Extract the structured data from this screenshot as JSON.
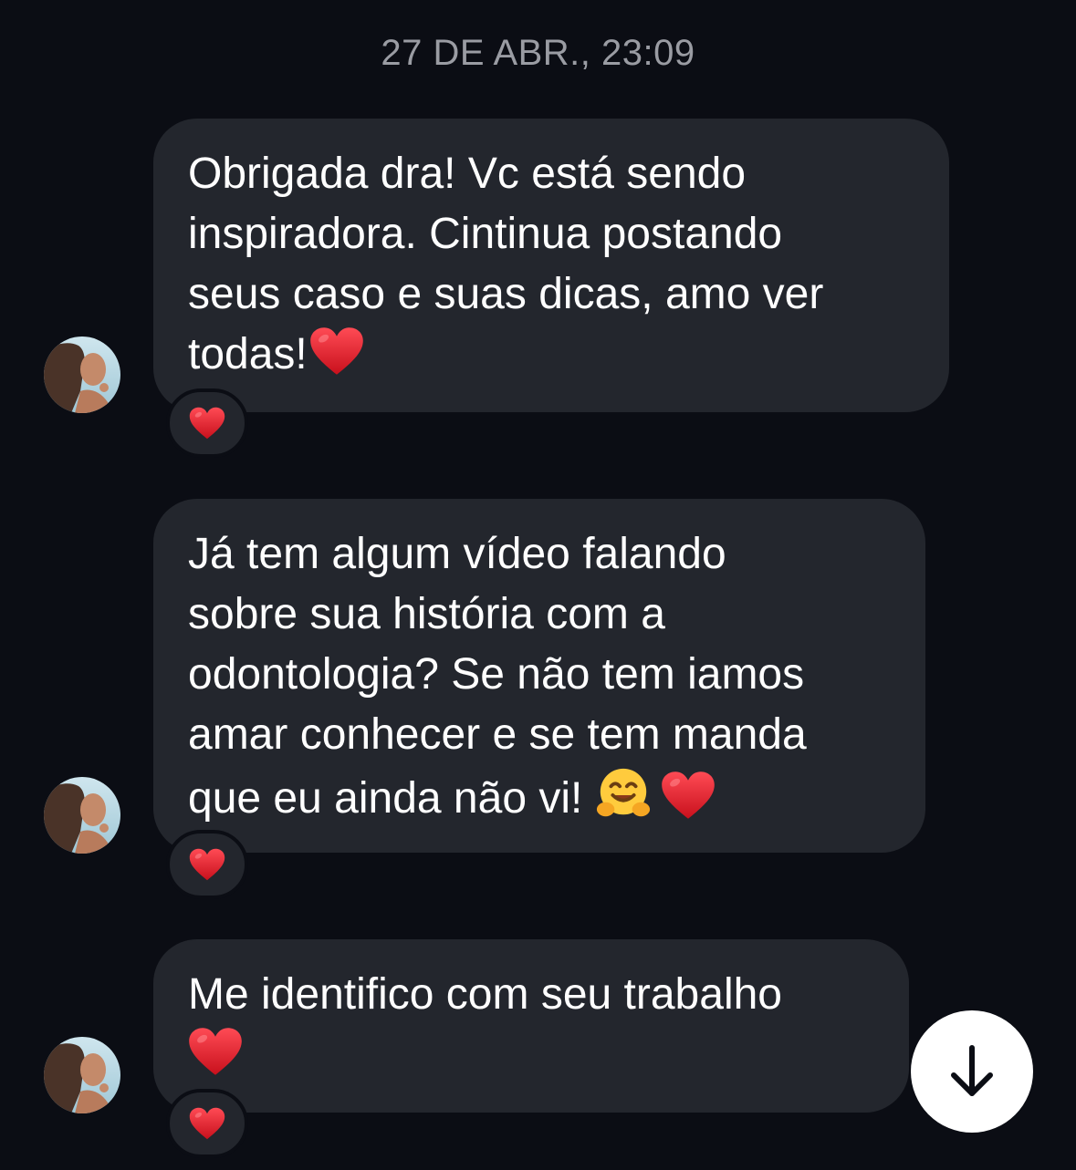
{
  "chat": {
    "timestamp": "27 DE ABR., 23:09",
    "messages": [
      {
        "text": "Obrigada dra! Vc está sendo\ninspiradora.  Cintinua postando\nseus caso e suas dicas,  amo ver\ntodas!",
        "trailing_emoji": [
          "red-heart"
        ],
        "reaction": "red-heart"
      },
      {
        "text": "Já tem algum vídeo falando\nsobre sua história com a\nodontologia? Se não tem iamos\namar conhecer e se tem manda\nque eu ainda não vi!",
        "trailing_emoji": [
          "hugging-face",
          "red-heart"
        ],
        "reaction": "red-heart"
      },
      {
        "text": "Me identifico com seu trabalho\n",
        "trailing_emoji": [
          "red-heart"
        ],
        "reaction": "red-heart"
      }
    ]
  },
  "controls": {
    "scroll_down_icon": "arrow-down-icon"
  },
  "colors": {
    "background": "#0b0d14",
    "bubble": "#23262d",
    "timestamp": "#9a9ca3",
    "heart": "#e8232f",
    "scroll_button": "#ffffff"
  }
}
